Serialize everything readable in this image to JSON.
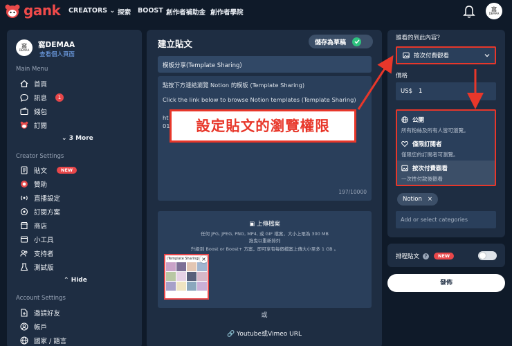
{
  "topbar": {
    "brand": "gank",
    "nav": [
      "CREATORS",
      "探索",
      "BOOST",
      "創作者補助金",
      "創作者學院"
    ],
    "avatar_text": "窩",
    "avatar_sub": "DEMAA"
  },
  "sidebar": {
    "profile_name": "窩DEMAA",
    "profile_link": "查看個人頁面",
    "main_menu_label": "Main Menu",
    "main_items": [
      {
        "label": "首頁",
        "icon": "home-icon"
      },
      {
        "label": "訊息",
        "icon": "chat-icon",
        "badge": "1"
      },
      {
        "label": "錢包",
        "icon": "wallet-icon"
      },
      {
        "label": "訂閱",
        "icon": "subscription-icon"
      }
    ],
    "more_label": "3 More",
    "creator_label": "Creator Settings",
    "creator_items": [
      {
        "label": "貼文",
        "icon": "post-icon",
        "badge": "NEW"
      },
      {
        "label": "贊助",
        "icon": "donate-icon"
      },
      {
        "label": "直播設定",
        "icon": "stream-icon"
      },
      {
        "label": "訂閱方案",
        "icon": "plan-icon"
      },
      {
        "label": "商店",
        "icon": "shop-icon"
      },
      {
        "label": "小工具",
        "icon": "widget-icon"
      },
      {
        "label": "支持者",
        "icon": "supporters-icon"
      },
      {
        "label": "測試版",
        "icon": "beta-icon"
      }
    ],
    "hide_label": "Hide",
    "account_label": "Account Settings",
    "account_items": [
      {
        "label": "邀請好友",
        "icon": "invite-icon"
      },
      {
        "label": "帳戶",
        "icon": "account-icon"
      },
      {
        "label": "國家 / 語言",
        "icon": "globe-icon"
      }
    ]
  },
  "main": {
    "title": "建立貼文",
    "draft_label": "儲存為草稿",
    "post_title": "模板分享(Template Sharing)",
    "body_lines": [
      "點按下方連結瀏覽 Notion 的模板 (Template Sharing)",
      "Click the link below to browse Notion templates (Template Sharing)",
      "ht",
      "01"
    ],
    "counter": "197/10000",
    "upload_title": "上傳檔案",
    "upload_line1": "任何 JPG, JPEG, PNG, MP4, 或 GIF 檔案，大小上限為 300 MB",
    "upload_line2": "拖曳以重新排列",
    "upload_line3": "升級到 Boost or Boost+ 方案，即可享有每個檔案上傳大小至多 1 GB 。",
    "thumb_caption": "(Template Sharing)",
    "or_label": "或",
    "youtube_label": "Youtube或Vimeo URL"
  },
  "right": {
    "who_label": "誰看的到此內容？",
    "visibility_value": "按次付費觀看",
    "price_label": "價格",
    "currency": "US$",
    "price_value": "1",
    "options": [
      {
        "title": "公開",
        "desc": "所有粉絲及所有人皆可瀏覽。",
        "icon": "globe-icon"
      },
      {
        "title": "僅限訂閱者",
        "desc": "僅限您的訂閱者可瀏覽。",
        "icon": "heart-icon"
      },
      {
        "title": "按次付費觀看",
        "desc": "一次性付款後觀看",
        "icon": "image-icon"
      }
    ],
    "tag": "Notion",
    "category_placeholder": "Add or select categories",
    "schedule_label": "排程貼文",
    "schedule_badge": "NEW",
    "publish_label": "發佈"
  },
  "callout": "設定貼文的瀏覽權限",
  "colors": {
    "accent_red": "#e8372a",
    "panel": "#1e2d42",
    "bg": "#0f1a29",
    "success": "#2ec27e"
  }
}
